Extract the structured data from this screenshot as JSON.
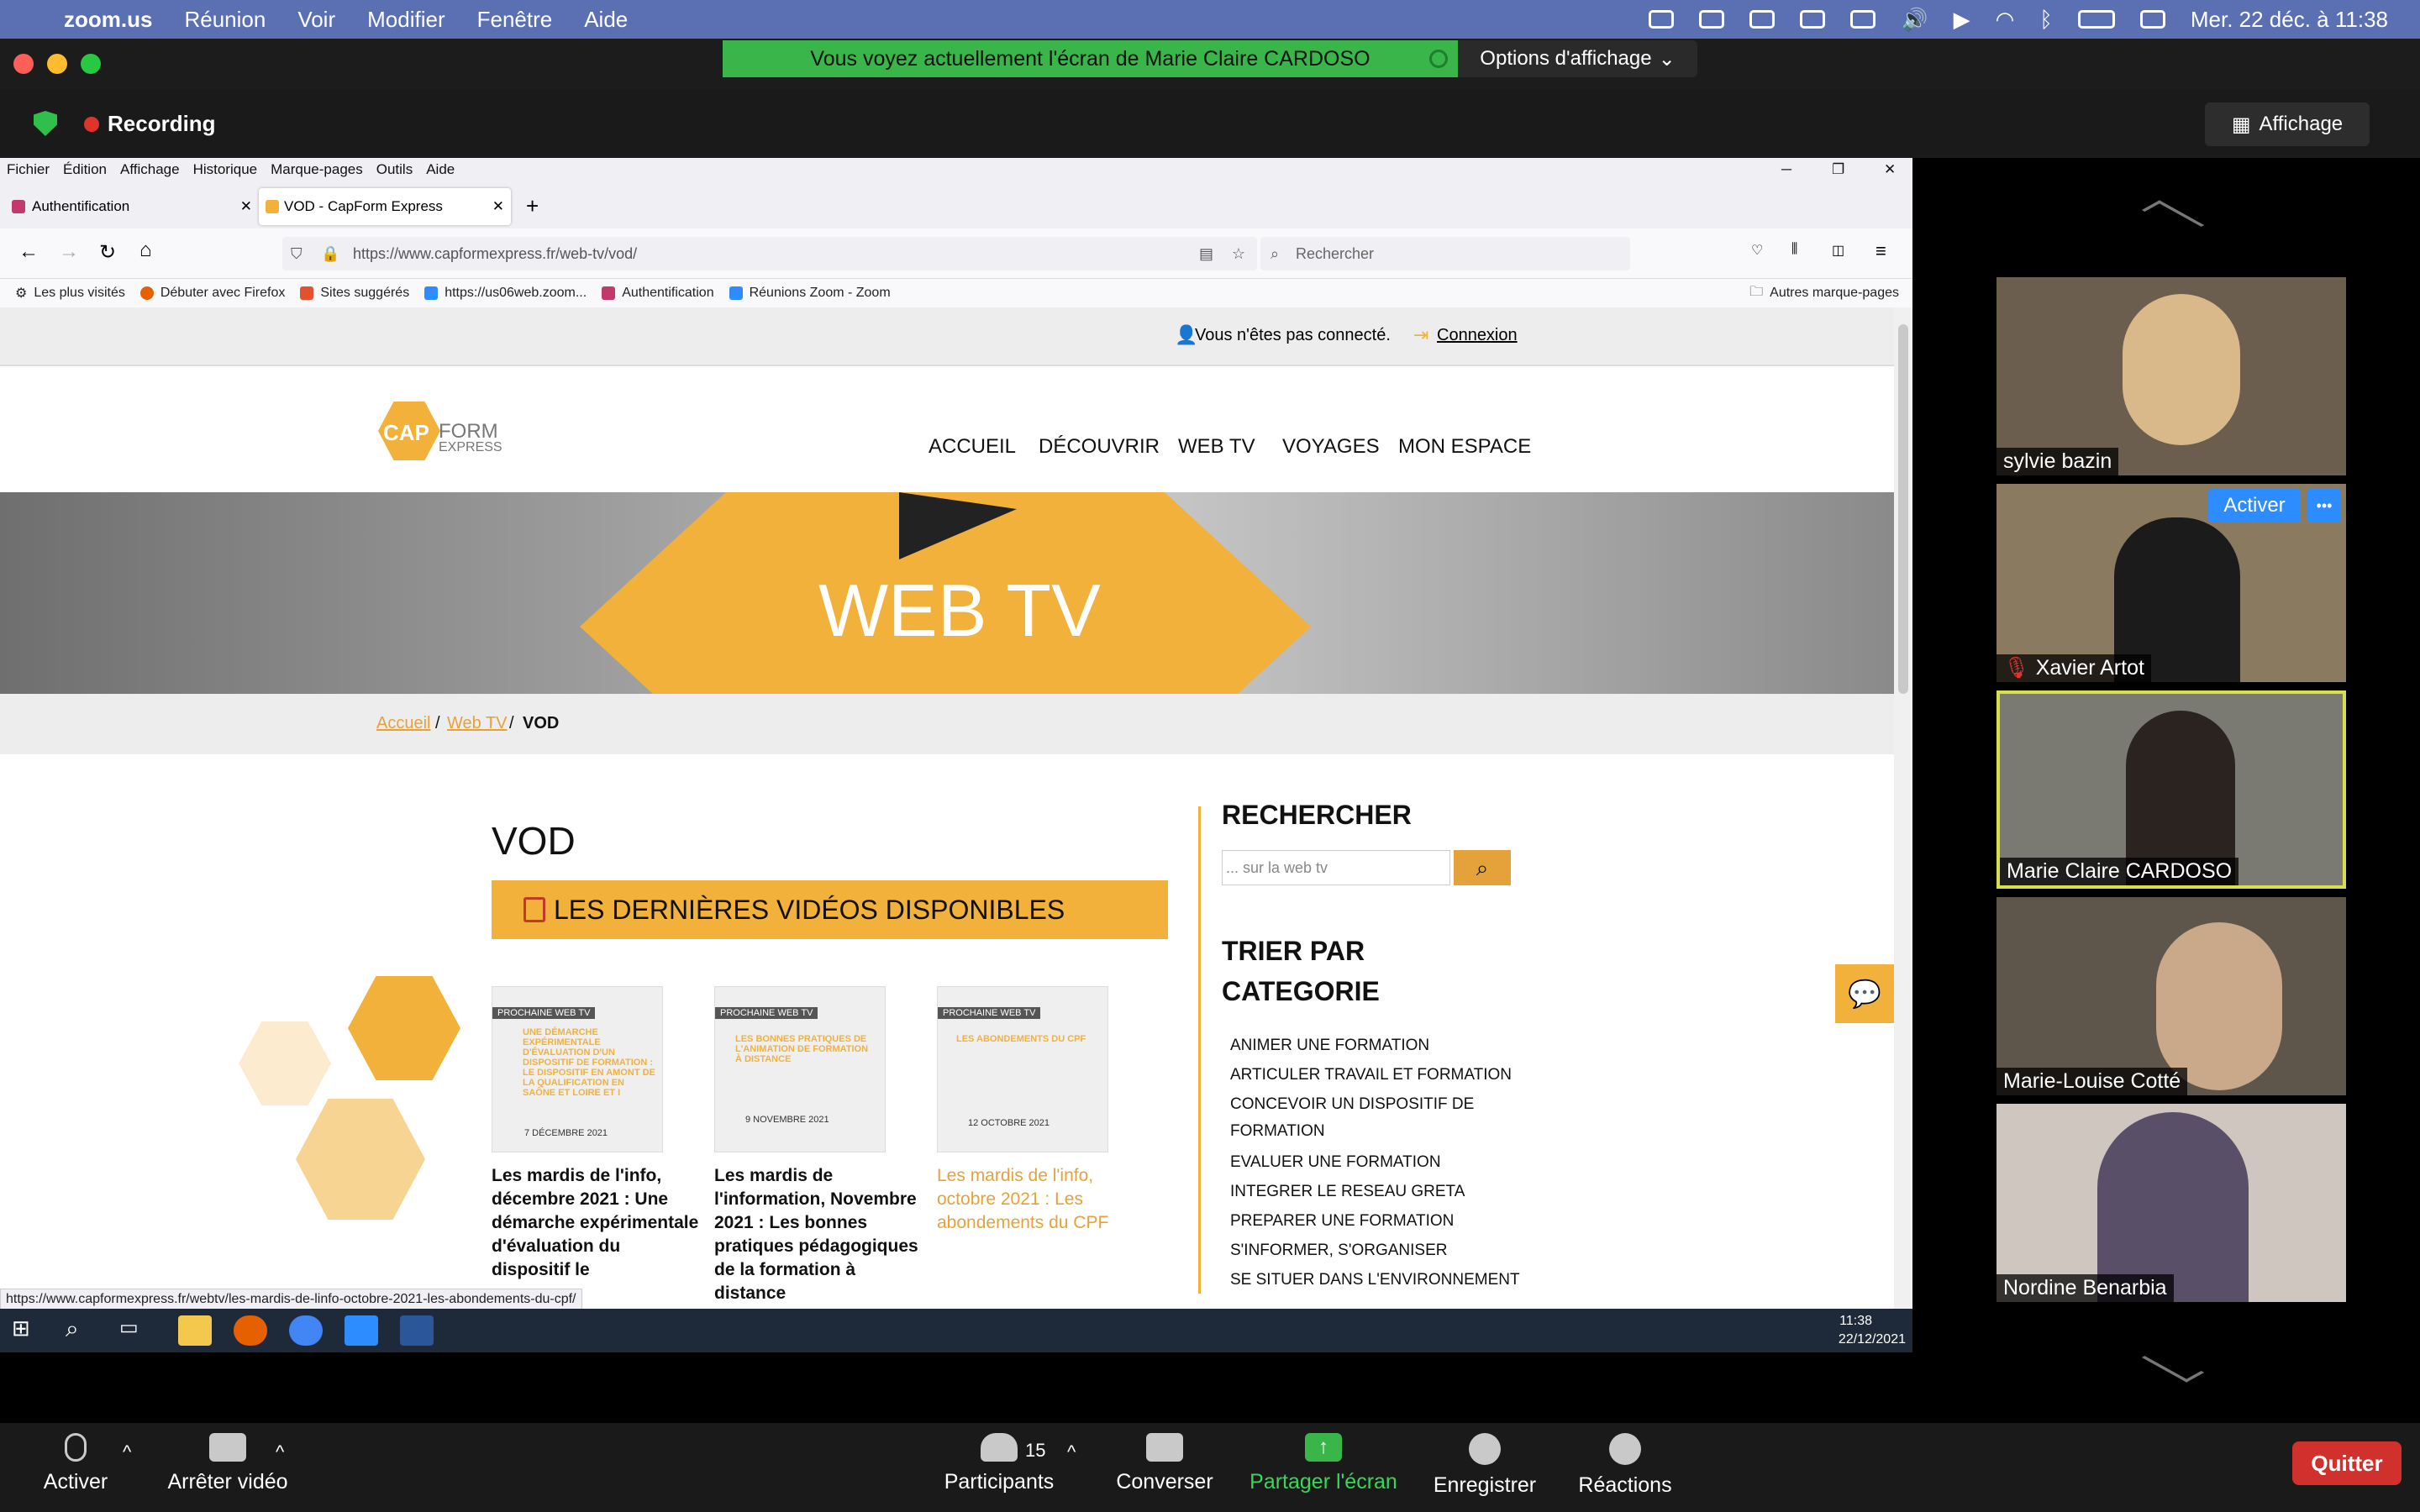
{
  "macos_menu": {
    "app": "zoom.us",
    "items": [
      "Réunion",
      "Voir",
      "Modifier",
      "Fenêtre",
      "Aide"
    ],
    "clock": "Mer. 22 déc. à 11:38"
  },
  "zoom_top": {
    "banner": "Vous voyez actuellement l'écran de Marie Claire CARDOSO",
    "options": "Options d'affichage",
    "recording": "Recording",
    "affichage": "Affichage"
  },
  "firefox": {
    "menu": [
      "Fichier",
      "Édition",
      "Affichage",
      "Historique",
      "Marque-pages",
      "Outils",
      "Aide"
    ],
    "tabs": [
      {
        "label": "Authentification"
      },
      {
        "label": "VOD - CapForm Express"
      }
    ],
    "url": "https://www.capformexpress.fr/web-tv/vod/",
    "search_placeholder": "Rechercher",
    "bookmarks": [
      "Les plus visités",
      "Débuter avec Firefox",
      "Sites suggérés",
      "https://us06web.zoom...",
      "Authentification",
      "Réunions Zoom - Zoom"
    ],
    "other_bookmarks": "Autres marque-pages",
    "status_url": "https://www.capformexpress.fr/webtv/les-mardis-de-linfo-octobre-2021-les-abondements-du-cpf/"
  },
  "site": {
    "not_connected": "Vous n'êtes pas connecté.",
    "login": "Connexion",
    "logo": {
      "cap": "CAP",
      "form": "FORM",
      "express": "EXPRESS"
    },
    "nav": [
      "ACCUEIL",
      "DÉCOUVRIR",
      "WEB TV",
      "VOYAGES",
      "MON ESPACE"
    ],
    "hero_title": "WEB TV",
    "breadcrumb": {
      "home": "Accueil",
      "sep": "/",
      "webtv": "Web TV",
      "current": "VOD"
    },
    "page_title": "VOD",
    "latest_banner": "LES DERNIÈRES VIDÉOS DISPONIBLES",
    "videos": [
      {
        "tag": "PROCHAINE WEB TV",
        "thumb_text": "UNE DÉMARCHE EXPÉRIMENTALE D'ÉVALUATION D'UN DISPOSITIF DE FORMATION : LE DISPOSITIF EN AMONT DE LA QUALIFICATION EN SAÔNE ET LOIRE ET I",
        "date": "7 DÉCEMBRE 2021",
        "title": "Les mardis de l'info, décembre 2021 : Une démarche expérimentale d'évaluation du dispositif le"
      },
      {
        "tag": "PROCHAINE WEB TV",
        "thumb_text": "LES BONNES PRATIQUES DE L'ANIMATION DE FORMATION À DISTANCE",
        "date": "9 NOVEMBRE 2021",
        "title": "Les mardis de l'information, Novembre 2021 : Les bonnes pratiques pédagogiques de la formation à distance"
      },
      {
        "tag": "PROCHAINE WEB TV",
        "thumb_text": "LES ABONDEMENTS DU CPF",
        "date": "12 OCTOBRE 2021",
        "title": "Les mardis de l'info, octobre 2021 : Les abondements du CPF"
      }
    ],
    "search_title": "RECHERCHER",
    "search_placeholder": "... sur la web tv",
    "sort_title": [
      "TRIER PAR",
      "CATEGORIE"
    ],
    "categories": [
      "ANIMER UNE FORMATION",
      "ARTICULER TRAVAIL ET FORMATION",
      "CONCEVOIR UN DISPOSITIF DE",
      "FORMATION",
      "EVALUER UNE FORMATION",
      "INTEGRER LE RESEAU GRETA",
      "PREPARER UNE FORMATION",
      "S'INFORMER, S'ORGANISER",
      "SE SITUER DANS L'ENVIRONNEMENT"
    ]
  },
  "windows_taskbar": {
    "time": "11:38",
    "date": "22/12/2021"
  },
  "participants": [
    {
      "name": "sylvie bazin"
    },
    {
      "name": "Xavier Artot",
      "activate": "Activer",
      "more": "•••"
    },
    {
      "name": "Marie Claire CARDOSO"
    },
    {
      "name": "Marie-Louise Cotté"
    },
    {
      "name": "Nordine Benarbia"
    }
  ],
  "toolbar": {
    "mute": "Activer",
    "video": "Arrêter vidéo",
    "participants": "Participants",
    "count": "15",
    "chat": "Converser",
    "share": "Partager l'écran",
    "record": "Enregistrer",
    "reactions": "Réactions",
    "quit": "Quitter"
  },
  "colors": {
    "accent": "#f2b13a",
    "mac_menu": "#5b6fb3",
    "share_green": "#39b54a",
    "quit_red": "#d0312d"
  }
}
